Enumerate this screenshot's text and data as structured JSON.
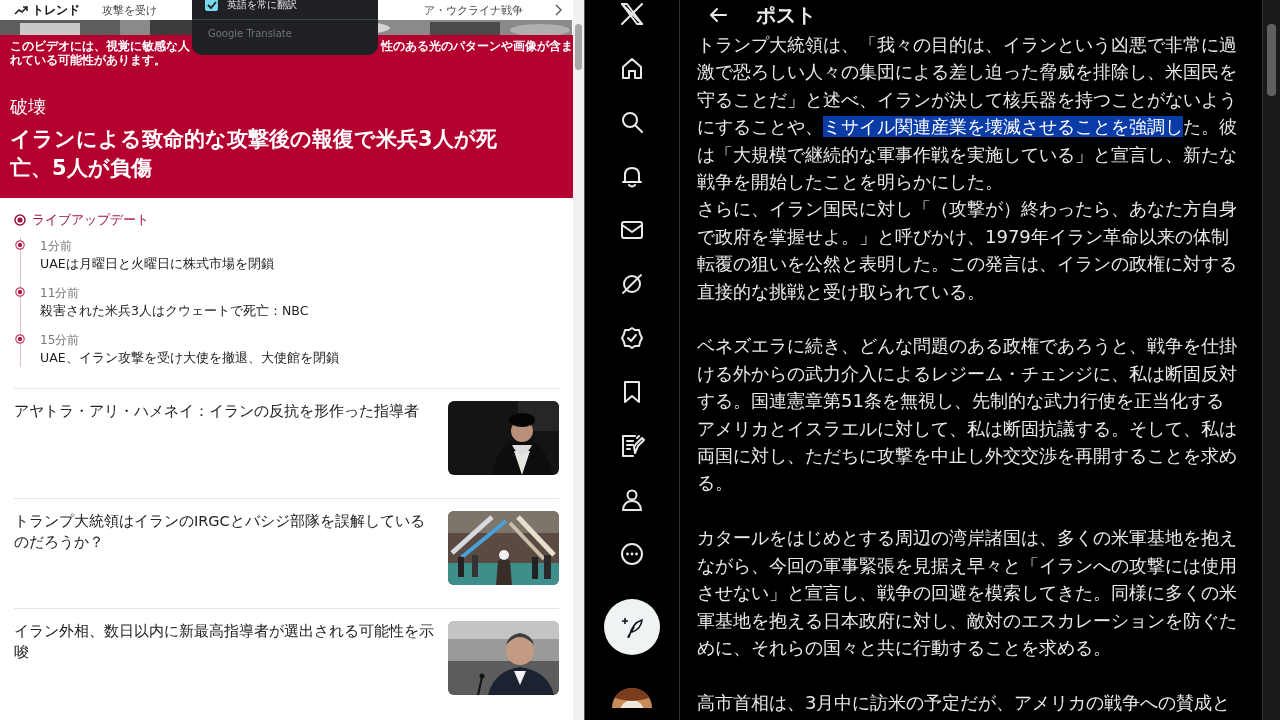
{
  "browser_top": {
    "trend_label": "トレンド",
    "topics": [
      "攻撃を受け",
      "ア・ウクライナ戦争"
    ]
  },
  "translate_popup": {
    "option": {
      "label": "英語を常に翻訳",
      "checked": true
    },
    "footer": "Google Translate"
  },
  "banner": {
    "warning_left": "このビデオには、視覚に敏感な人",
    "warning_right": "性のある光のパターンや画像が含ま",
    "warning_line2": "れている可能性があります。",
    "category": "破壊",
    "headline": "イランによる致命的な攻撃後の報復で米兵3人が死亡、5人が負傷"
  },
  "live": {
    "title": "ライブアップデート",
    "items": [
      {
        "time": "1分前",
        "text": "UAEは月曜日と火曜日に株式市場を閉鎖"
      },
      {
        "time": "11分前",
        "text": "殺害された米兵3人はクウェートで死亡：NBC"
      },
      {
        "time": "15分前",
        "text": "UAE、イラン攻撃を受け大使を撤退、大使館を閉鎖"
      }
    ]
  },
  "articles": [
    {
      "title": "アヤトラ・アリ・ハメネイ：イランの反抗を形作った指導者"
    },
    {
      "title": "トランプ大統領はイランのIRGCとバシジ部隊を誤解しているのだろうか？"
    },
    {
      "title": "イラン外相、数日以内に新最高指導者が選出される可能性を示唆"
    }
  ],
  "post": {
    "title": "ポスト",
    "blocks": [
      {
        "paragraphs": [
          {
            "segments": [
              {
                "text": "トランプ大統領は、「我々の目的は、イランという凶悪で非常に過激で恐ろしい人々の集団による差し迫った脅威を排除し、米国民を守ることだ」と述べ、イランが決して核兵器を持つことがないようにすることや、",
                "selected": false
              },
              {
                "text": "ミサイル関連産業を壊滅させることを強調し",
                "selected": true
              },
              {
                "text": "た。彼は「大規模で継続的な軍事作戦を実施している」と宣言し、新たな戦争を開始したことを明らかにした。",
                "selected": false
              }
            ]
          },
          {
            "segments": [
              {
                "text": "さらに、イラン国民に対し「（攻撃が）終わったら、あなた方自身で政府を掌握せよ。」と呼びかけ、1979年イラン革命以来の体制転覆の狙いを公然と表明した。この発言は、イランの政権に対する直接的な挑戦と受け取られている。",
                "selected": false
              }
            ]
          }
        ]
      },
      {
        "paragraphs": [
          {
            "segments": [
              {
                "text": "ベネズエラに続き、どんな問題のある政権であろうと、戦争を仕掛ける外からの武力介入によるレジーム・チェンジに、私は断固反対する。国連憲章第51条を無視し、先制的な武力行使を正当化するアメリカとイスラエルに対して、私は断固抗議する。そして、私は両国に対し、ただちに攻撃を中止し外交交渉を再開することを求める。",
                "selected": false
              }
            ]
          }
        ]
      },
      {
        "paragraphs": [
          {
            "segments": [
              {
                "text": "カタールをはじめとする周辺の湾岸諸国は、多くの米軍基地を抱えながら、今回の軍事緊張を見据え早々と「イランへの攻撃には使用させない」と宣言し、戦争の回避を模索してきた。同様に多くの米軍基地を抱える日本政府に対し、敵対のエスカレーションを防ぐために、それらの国々と共に行動することを求める。",
                "selected": false
              }
            ]
          }
        ]
      },
      {
        "paragraphs": [
          {
            "segments": [
              {
                "text": "高市首相は、3月中に訪米の予定だが、アメリカの戦争への賛成と",
                "selected": false
              }
            ]
          }
        ]
      }
    ]
  }
}
